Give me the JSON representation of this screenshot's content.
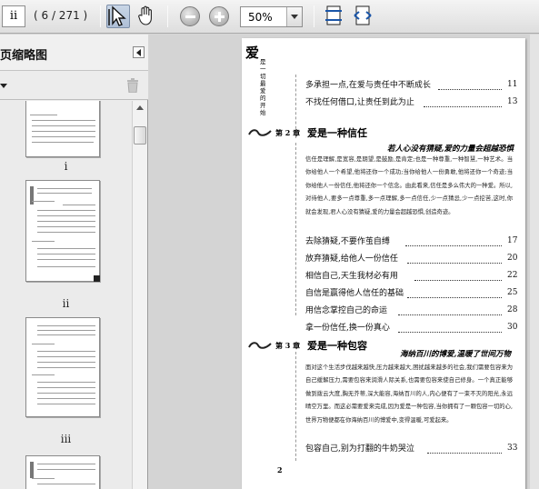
{
  "toolbar": {
    "page_field_value": "ii",
    "page_count": "( 6 / 271 )",
    "zoom_value": "50%",
    "icons": [
      "select-arrow-icon",
      "hand-icon",
      "zoom-out-icon",
      "zoom-in-icon",
      "fit-page-icon",
      "fit-width-icon"
    ]
  },
  "sidebar": {
    "title": "页缩略图",
    "thumbnails": [
      {
        "label": "i"
      },
      {
        "label": "ii"
      },
      {
        "label": "iii"
      },
      {
        "label": ""
      }
    ]
  },
  "document": {
    "side_title_big": "爱",
    "side_title_vertical": "是一切最爱的开始",
    "top_entries": [
      {
        "title": "多承担一点,在爱与责任中不断成长",
        "page": "11"
      },
      {
        "title": "不找任何借口,让责任到此为止",
        "page": "13"
      }
    ],
    "chapter2": {
      "num": "第 2 章",
      "title": "爱是一种信任",
      "subtitle": "若人心没有猜疑,爱的力量会超越恐惧",
      "paragraph": "信任是理解,是宽容,是期望,是鼓励,是肯定;也是一种尊重,一种智慧,一种艺术。当你给他人一个希望,他将还你一个成功;当你给他人一份勇敢,他将还你一个奇迹;当你给他人一份信任,他将还你一个信念。由此看来,信任是多么伟大的一种爱。所以,对待他人,要多一点尊重,多一点理解,多一点信任,少一点猜忌,少一点挖苦,这时,你就会发现,君人心没有猜疑,爱的力量会超越恐惧,创造奇迹。",
      "entries": [
        {
          "title": "去除猜疑,不要作茧自缚",
          "page": "17"
        },
        {
          "title": "放弃猜疑,给他人一份信任",
          "page": "20"
        },
        {
          "title": "相信自己,天生我材必有用",
          "page": "22"
        },
        {
          "title": "自信是赢得他人信任的基础",
          "page": "25"
        },
        {
          "title": "用信念掌控自己的命运",
          "page": "28"
        },
        {
          "title": "拿一份信任,换一份真心",
          "page": "30"
        }
      ]
    },
    "chapter3": {
      "num": "第 3 章",
      "title": "爱是一种包容",
      "subtitle": "海纳百川的博爱,温暖了世间万物",
      "paragraph": "面对这个生活步伐越来越快,压力越来越大,困扰越来越多的社会,我们需要包容来为自己缓解压力,需要包容来润滑人际关系,也需要包容来使自己修身。一个真正能够做到拨云大度,胸无芥蒂,深大能容,海纳百川的人,内心便有了一束不灭的阳光,永远晴空万里。而这必需要爱来完成,因为爱是一种包容,当你拥有了一颗包容一切的心,世界万物便都在你海纳百川的博爱中,变得温暖,可爱起来。",
      "entries": [
        {
          "title": "包容自己,别为打翻的牛奶哭泣",
          "page": "33"
        }
      ]
    },
    "page_number": "2"
  }
}
